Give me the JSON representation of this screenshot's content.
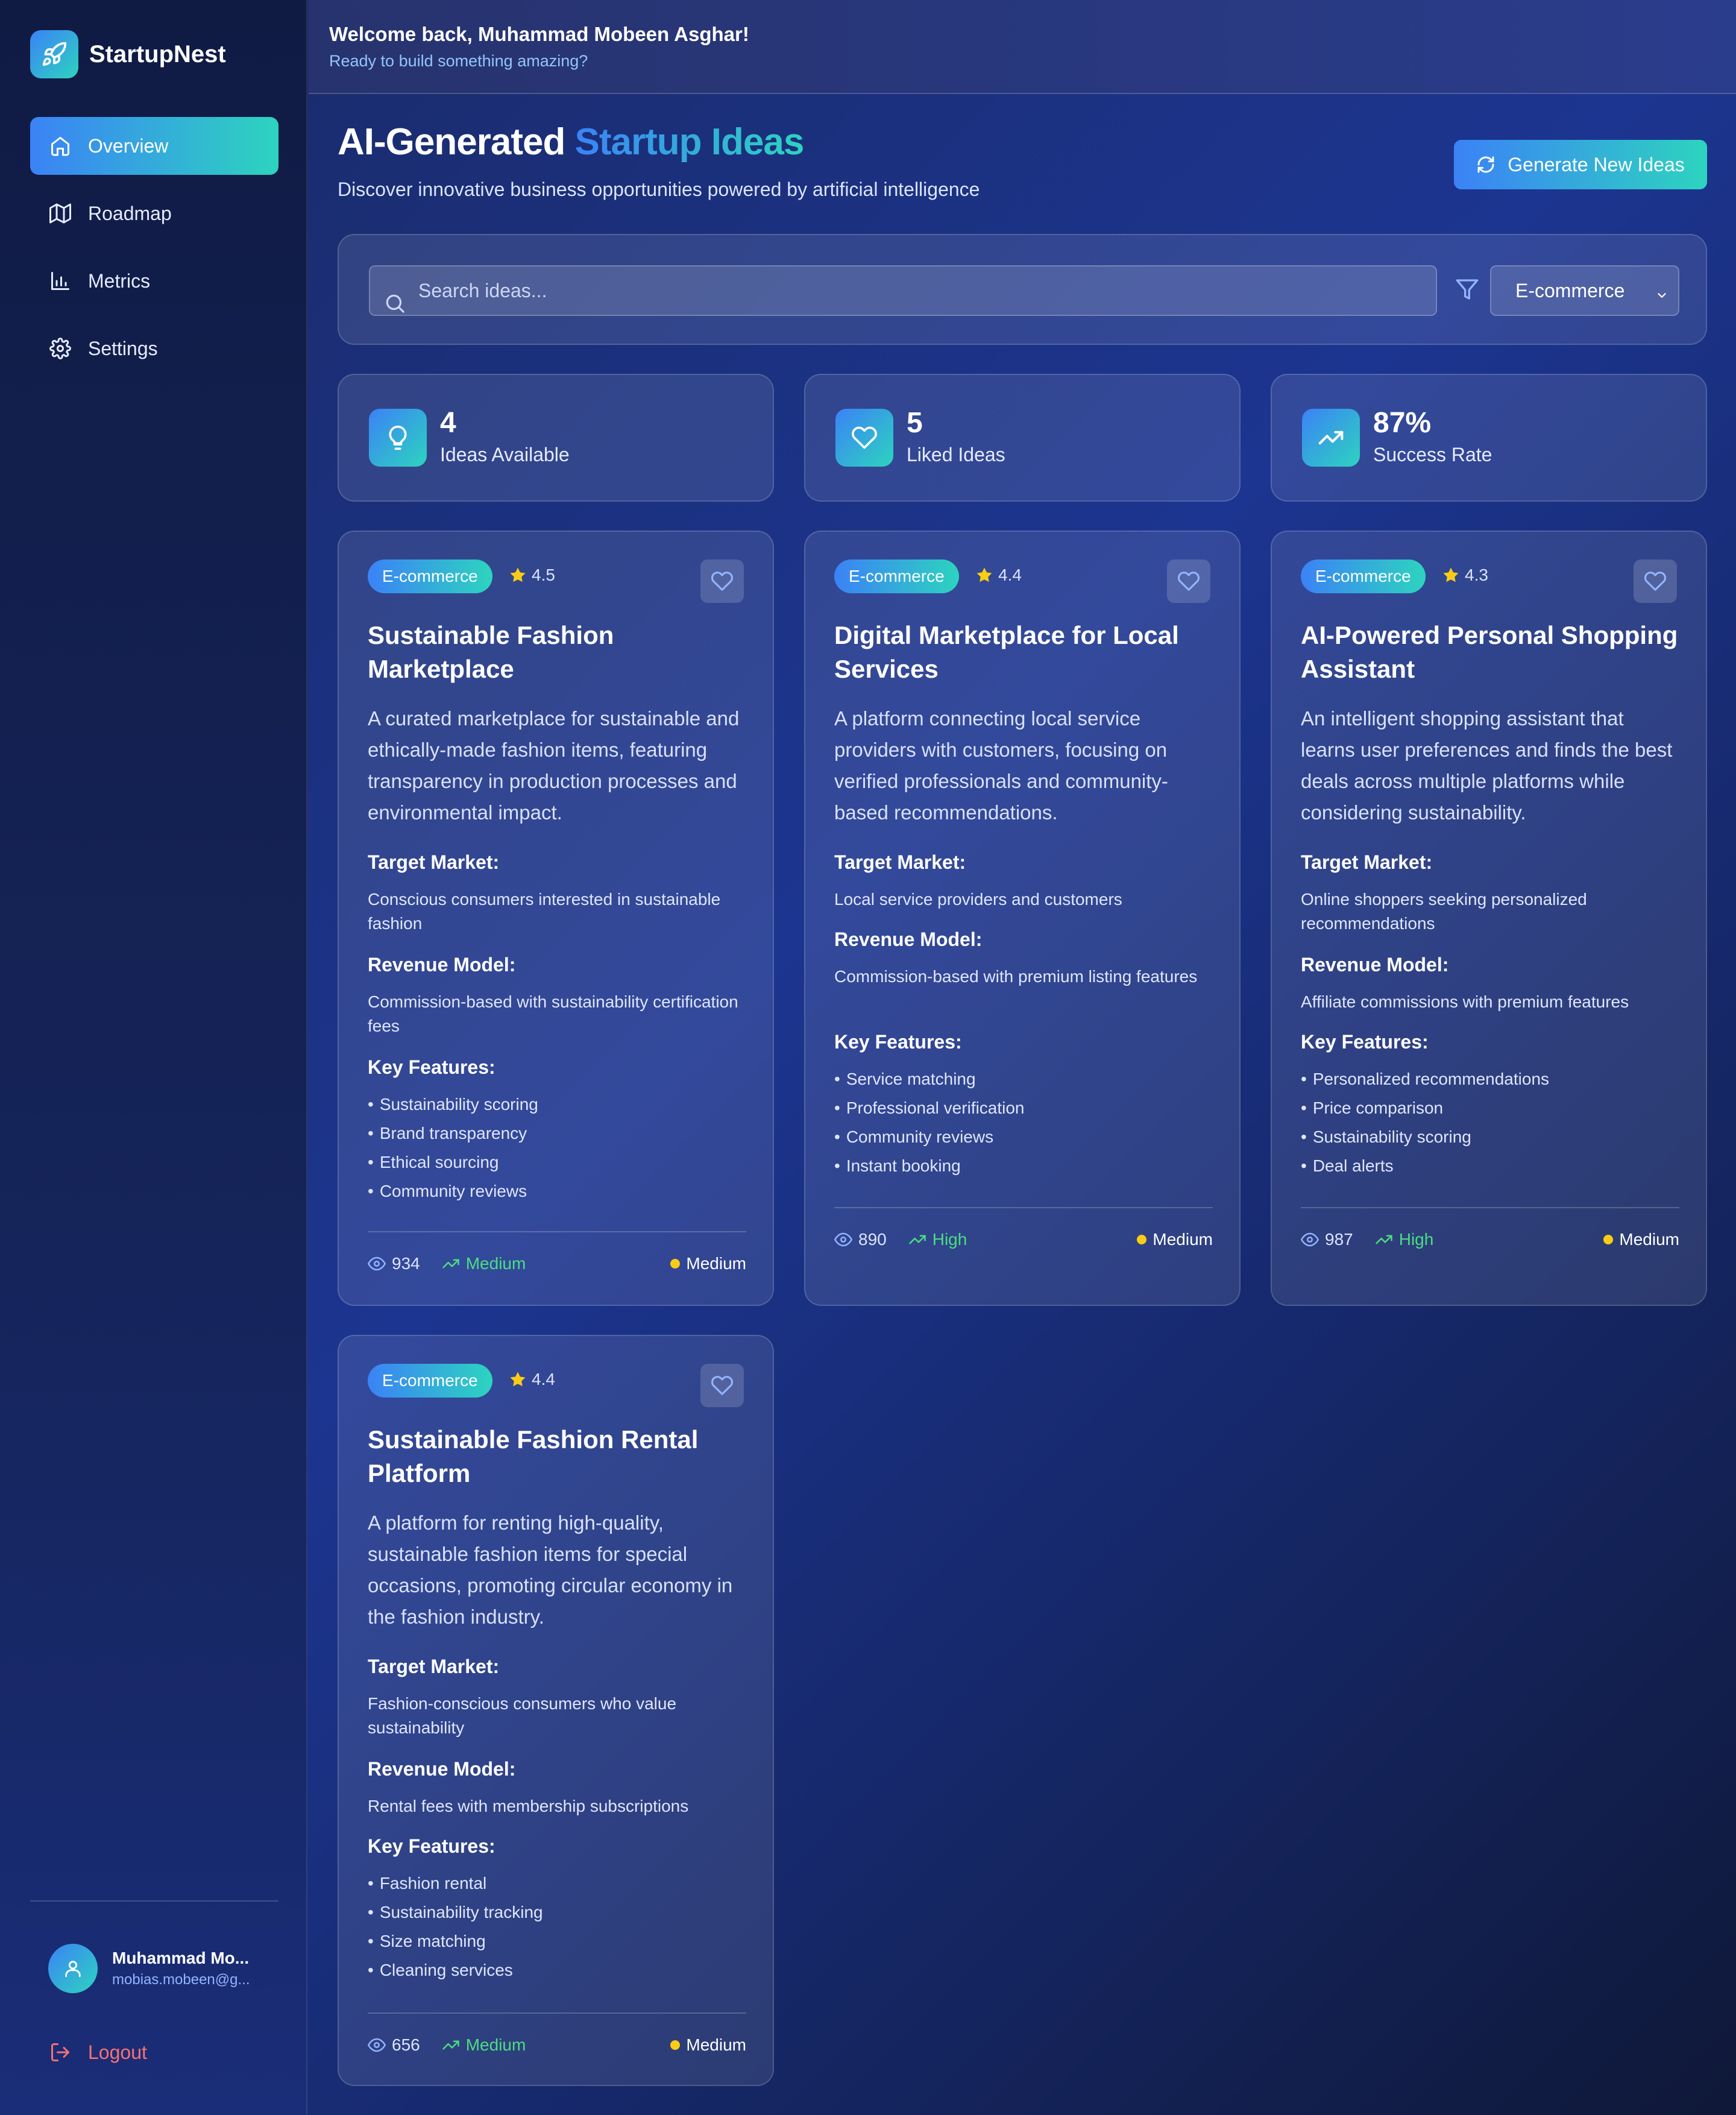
{
  "brand": {
    "name": "StartupNest",
    "logo_icon": "rocket-icon"
  },
  "sidebar": {
    "items": [
      {
        "label": "Overview",
        "icon": "home-icon",
        "active": true
      },
      {
        "label": "Roadmap",
        "icon": "map-icon",
        "active": false
      },
      {
        "label": "Metrics",
        "icon": "bar-chart-icon",
        "active": false
      },
      {
        "label": "Settings",
        "icon": "gear-icon",
        "active": false
      }
    ],
    "user": {
      "name": "Muhammad Mo...",
      "email": "mobias.mobeen@g..."
    },
    "logout_label": "Logout"
  },
  "topbar": {
    "welcome": "Welcome back, Muhammad Mobeen Asghar!",
    "subtitle": "Ready to build something amazing?"
  },
  "header": {
    "title_main": "AI-Generated ",
    "title_accent": "Startup Ideas",
    "subtitle": "Discover innovative business opportunities powered by artificial intelligence",
    "generate_button": "Generate New Ideas"
  },
  "search": {
    "placeholder": "Search ideas...",
    "value": "",
    "filter_selected": "E-commerce"
  },
  "stats": [
    {
      "value": "4",
      "label": "Ideas Available",
      "icon": "lightbulb-icon"
    },
    {
      "value": "5",
      "label": "Liked Ideas",
      "icon": "heart-icon"
    },
    {
      "value": "87%",
      "label": "Success Rate",
      "icon": "trending-up-icon"
    }
  ],
  "labels": {
    "target_market": "Target Market:",
    "revenue_model": "Revenue Model:",
    "key_features": "Key Features:"
  },
  "ideas": [
    {
      "category": "E-commerce",
      "rating": "4.5",
      "title": "Sustainable Fashion Marketplace",
      "description": "A curated marketplace for sustainable and ethically-made fashion items, featuring transparency in production processes and environmental impact.",
      "target_market": "Conscious consumers interested in sustainable fashion",
      "revenue_model": "Commission-based with sustainability certification fees",
      "features": [
        "Sustainability scoring",
        "Brand transparency",
        "Ethical sourcing",
        "Community reviews"
      ],
      "views": "934",
      "potential": "Medium",
      "difficulty": "Medium"
    },
    {
      "category": "E-commerce",
      "rating": "4.4",
      "title": "Digital Marketplace for Local Services",
      "description": "A platform connecting local service providers with customers, focusing on verified professionals and community-based recommendations.",
      "target_market": "Local service providers and customers",
      "revenue_model": "Commission-based with premium listing features",
      "features": [
        "Service matching",
        "Professional verification",
        "Community reviews",
        "Instant booking"
      ],
      "views": "890",
      "potential": "High",
      "difficulty": "Medium"
    },
    {
      "category": "E-commerce",
      "rating": "4.3",
      "title": "AI-Powered Personal Shopping Assistant",
      "description": "An intelligent shopping assistant that learns user preferences and finds the best deals across multiple platforms while considering sustainability.",
      "target_market": "Online shoppers seeking personalized recommendations",
      "revenue_model": "Affiliate commissions with premium features",
      "features": [
        "Personalized recommendations",
        "Price comparison",
        "Sustainability scoring",
        "Deal alerts"
      ],
      "views": "987",
      "potential": "High",
      "difficulty": "Medium"
    },
    {
      "category": "E-commerce",
      "rating": "4.4",
      "title": "Sustainable Fashion Rental Platform",
      "description": "A platform for renting high-quality, sustainable fashion items for special occasions, promoting circular economy in the fashion industry.",
      "target_market": "Fashion-conscious consumers who value sustainability",
      "revenue_model": "Rental fees with membership subscriptions",
      "features": [
        "Fashion rental",
        "Sustainability tracking",
        "Size matching",
        "Cleaning services"
      ],
      "views": "656",
      "potential": "Medium",
      "difficulty": "Medium"
    }
  ]
}
